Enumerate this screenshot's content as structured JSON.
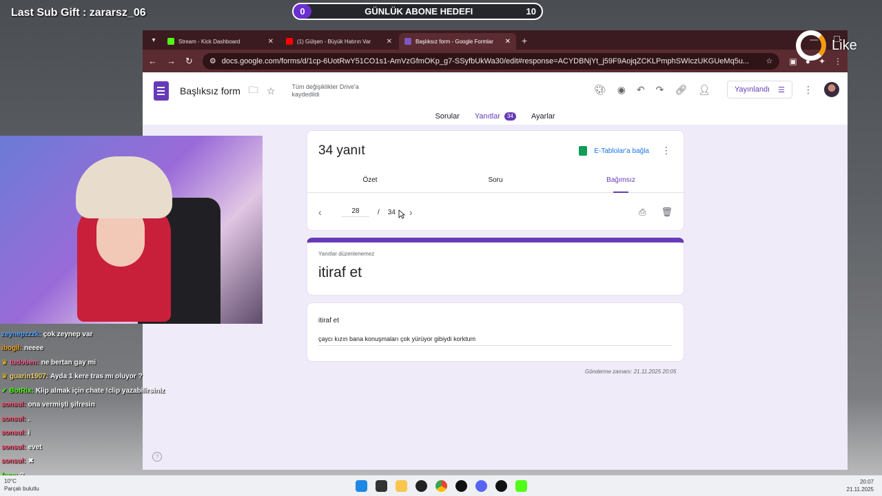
{
  "overlay": {
    "last_sub_gift": "Last Sub Gift : zararsz_06",
    "goal_current": "0",
    "goal_title": "GÜNLÜK ABONE HEDEFI",
    "goal_target": "10",
    "brand": "Like"
  },
  "browser": {
    "tabs": [
      {
        "label": "Stream - Kick Dashboard",
        "favicon_color": "#53fc18"
      },
      {
        "label": "(1) Gülşen - Büyük Hatırın Var",
        "favicon_color": "#ff0000"
      },
      {
        "label": "Başlıksız form - Google Formlar",
        "favicon_color": "#7e57c2"
      }
    ],
    "url": "docs.google.com/forms/d/1cp-6UotRwY51CO1s1-AmVzGfmOKp_g7-SSyfbUkWa30/edit#response=ACYDBNjYt_j59F9AojqZCKLPmphSWIczUKGUeMq5u..."
  },
  "forms": {
    "title": "Başlıksız form",
    "saved_status": "Tüm değişiklikler Drive'a kaydedildi",
    "publish_label": "Yayınlandı",
    "tabs": [
      {
        "label": "Sorular"
      },
      {
        "label": "Yanıtlar",
        "count": "34"
      },
      {
        "label": "Ayarlar"
      }
    ],
    "response_count": "34 yanıt",
    "sheets_link": "E-Tablolar'a bağla",
    "sub_tabs": [
      "Özet",
      "Soru",
      "Bağımsız"
    ],
    "pager_current": "28",
    "pager_sep": "/",
    "pager_total": "34",
    "not_editable_note": "Yanıtlar düzenlenemez",
    "form_heading": "itiraf et",
    "question": "itiraf et",
    "answer": "çaycı kızın bana konuşmaları çok yürüyor gibiydi korktum",
    "submit_time": "Gönderme zamanı: 21.11.2025 20:05"
  },
  "chat": [
    {
      "user": "zeynepzzzk:",
      "msg": "çok zeynep var",
      "color": "#4fa3ff"
    },
    {
      "user": "ibogil:",
      "msg": "neeee",
      "color": "#f5a623"
    },
    {
      "user": "tudoben:",
      "msg": "ne bertan gay mi",
      "color": "#ff5c8a"
    },
    {
      "user": "guarin1907:",
      "msg": "Ayda 1 kere tras mı oluyor ?",
      "color": "#f5d76e"
    },
    {
      "user": "BotRix:",
      "msg": "Klip almak için chate !clip yazabilirsiniz",
      "color": "#53fc18"
    },
    {
      "user": "sonsul:",
      "msg": "ona vermişti şifresin",
      "color": "#ff4d6d"
    },
    {
      "user": "sonsul:",
      "msg": ".",
      "color": "#ff4d6d"
    },
    {
      "user": "sonsul:",
      "msg": "i",
      "color": "#ff4d6d"
    },
    {
      "user": "sonsul:",
      "msg": "evet",
      "color": "#ff4d6d"
    },
    {
      "user": "sonsul:",
      "msg": "",
      "color": "#ff4d6d"
    },
    {
      "user": "foca:",
      "msg": "?",
      "color": "#53fc18"
    }
  ],
  "taskbar": {
    "weather": "10°C",
    "weather_sub": "Parçalı bulutlu",
    "time": "20:07",
    "date": "21.11.2025"
  }
}
